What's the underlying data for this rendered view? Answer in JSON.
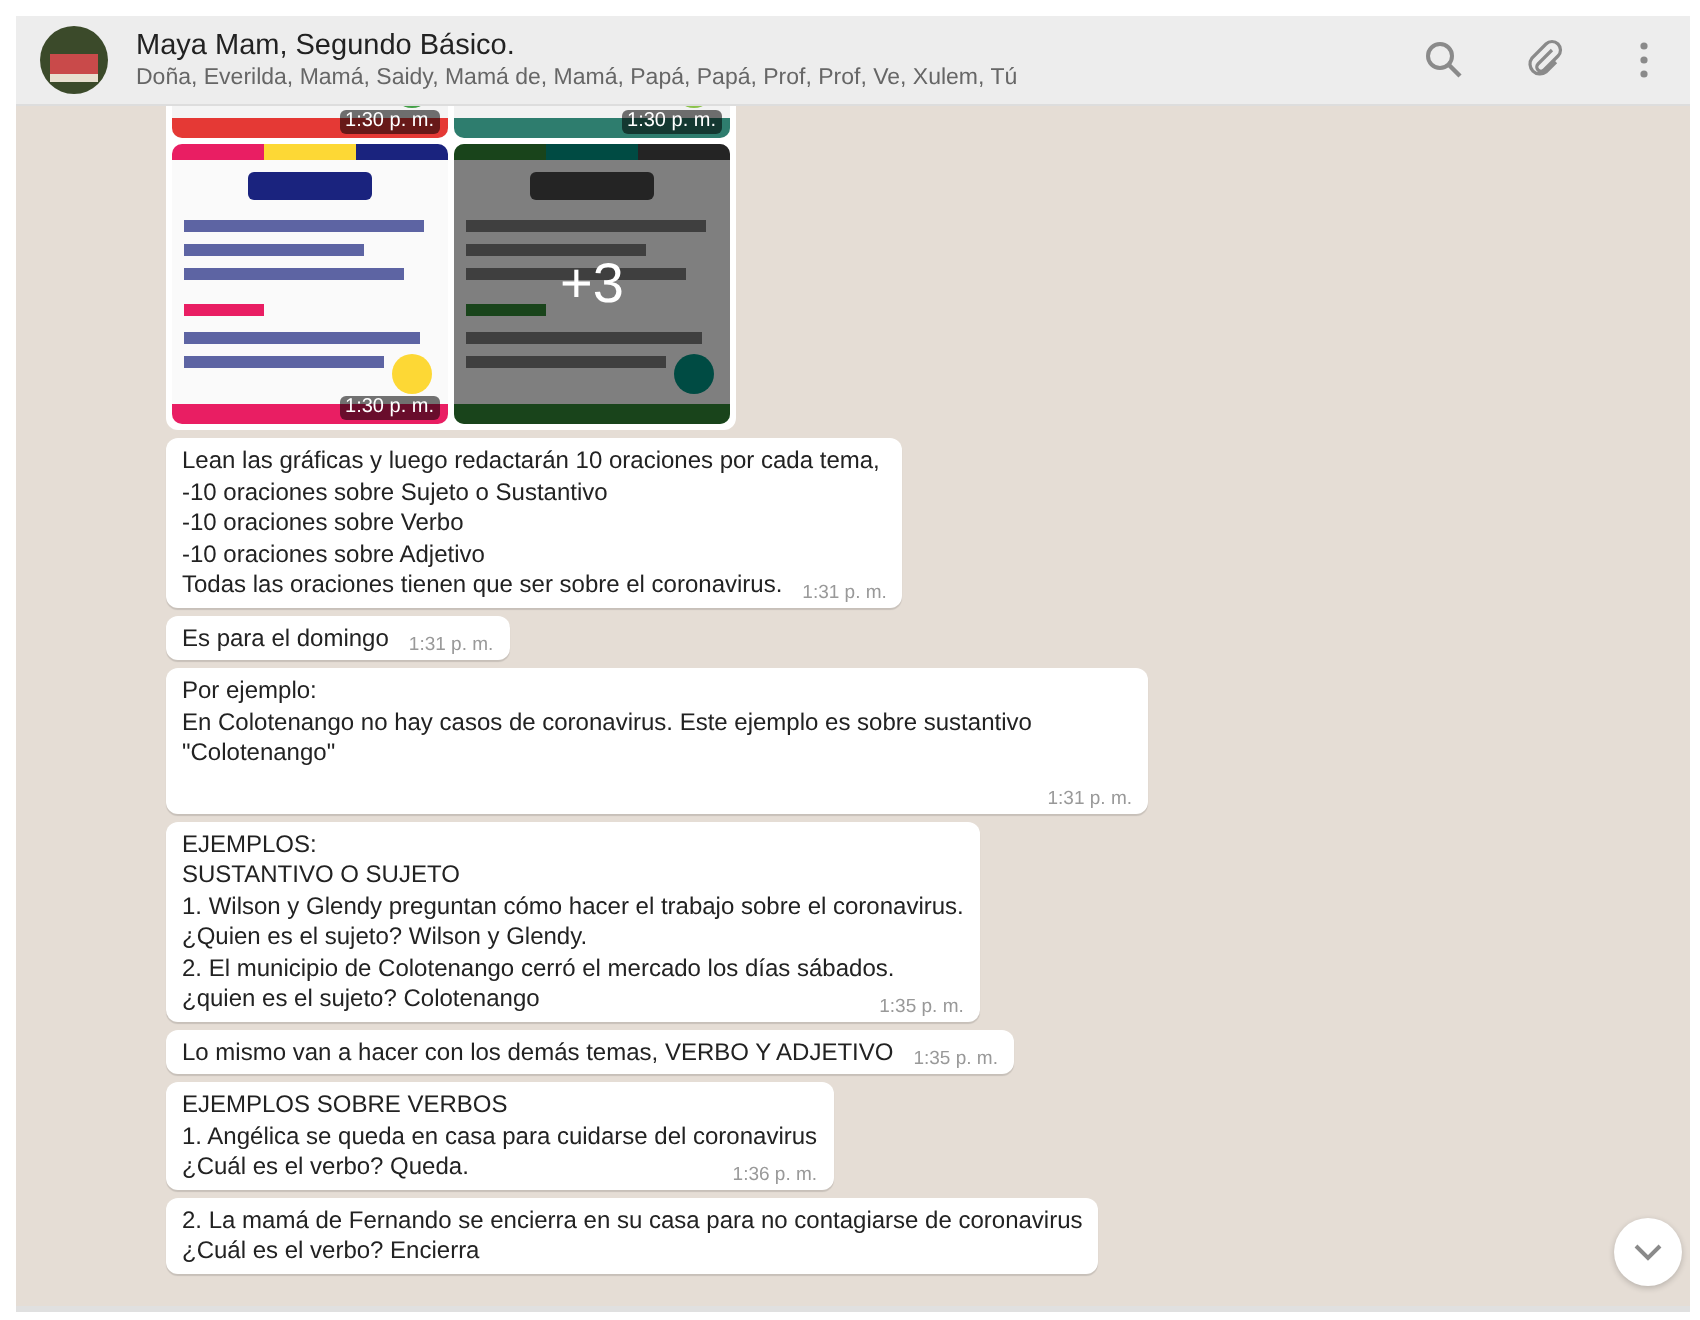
{
  "header": {
    "title": "Maya Mam, Segundo Básico.",
    "subtitle": "Doña, Everilda, Mamá, Saidy, Mamá de, Mamá, Papá, Papá, Prof, Prof, Ve, Xulem, Tú"
  },
  "messages": [
    {
      "kind": "images",
      "tiles": [
        {
          "time": "1:30 p. m.",
          "cut": true
        },
        {
          "time": "1:30 p. m.",
          "cut": true
        },
        {
          "time": "1:30 p. m.",
          "cut": false
        },
        {
          "more": "+3",
          "cut": false
        }
      ]
    },
    {
      "kind": "text",
      "lines": [
        "Lean las gráficas y luego redactarán 10 oraciones por cada tema,",
        "-10 oraciones sobre Sujeto o Sustantivo",
        "-10 oraciones sobre Verbo",
        "-10 oraciones sobre Adjetivo",
        "Todas las oraciones tienen que ser sobre el coronavirus."
      ],
      "time": "1:31 p. m."
    },
    {
      "kind": "text",
      "lines": [
        "Es para el domingo"
      ],
      "time": "1:31 p. m."
    },
    {
      "kind": "text",
      "lines": [
        "Por ejemplo:",
        "En Colotenango no hay casos de coronavirus. Este ejemplo es sobre sustantivo \"Colotenango\""
      ],
      "time": "1:31 p. m."
    },
    {
      "kind": "text",
      "lines": [
        "EJEMPLOS:",
        "SUSTANTIVO O SUJETO",
        "1. Wilson y Glendy preguntan cómo hacer el trabajo sobre el coronavirus.",
        "¿Quien es el sujeto? Wilson y Glendy.",
        "2. El municipio de Colotenango cerró el mercado los días sábados.",
        "¿quien es el sujeto? Colotenango"
      ],
      "time": "1:35 p. m."
    },
    {
      "kind": "text",
      "lines": [
        "Lo mismo van a hacer con los demás temas, VERBO Y ADJETIVO"
      ],
      "time": "1:35 p. m."
    },
    {
      "kind": "text",
      "lines": [
        "EJEMPLOS SOBRE VERBOS",
        "1. Angélica se queda en casa para cuidarse del coronavirus",
        "¿Cuál es el verbo? Queda."
      ],
      "time": "1:36 p. m."
    },
    {
      "kind": "text",
      "lines": [
        "2. La mamá de Fernando se encierra en su casa para no contagiarse de coronavirus",
        "¿Cuál es el verbo? Encierra"
      ]
    }
  ]
}
